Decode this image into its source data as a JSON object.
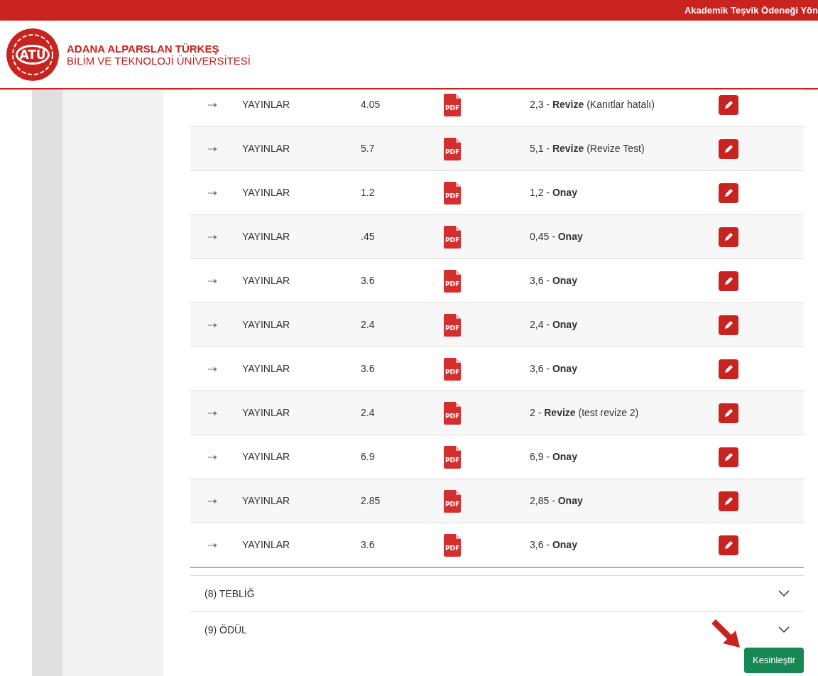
{
  "top_bar": {
    "title": "Akademik Teşvik Ödeneği Yön"
  },
  "logo": {
    "mark": "ATÜ",
    "line_1": "ADANA ALPARSLAN TÜRKEŞ",
    "line_2": "BİLİM VE TEKNOLOJİ ÜNİVERSİTESİ"
  },
  "table": {
    "rows": [
      {
        "category": "YAYINLAR",
        "score": "4.05",
        "file": "PDF",
        "status": "2,3 - **Revize** (Kanıtlar hatalı)"
      },
      {
        "category": "YAYINLAR",
        "score": "5.7",
        "file": "PDF",
        "status": "5,1 - **Revize** (Revize Test)"
      },
      {
        "category": "YAYINLAR",
        "score": "1.2",
        "file": "PDF",
        "status": "1,2 - **Onay**"
      },
      {
        "category": "YAYINLAR",
        "score": ".45",
        "file": "PDF",
        "status": "0,45 - **Onay**"
      },
      {
        "category": "YAYINLAR",
        "score": "3.6",
        "file": "PDF",
        "status": "3,6 - **Onay**"
      },
      {
        "category": "YAYINLAR",
        "score": "2.4",
        "file": "PDF",
        "status": "2,4 - **Onay**"
      },
      {
        "category": "YAYINLAR",
        "score": "3.6",
        "file": "PDF",
        "status": "3,6 - **Onay**"
      },
      {
        "category": "YAYINLAR",
        "score": "2.4",
        "file": "PDF",
        "status": "2 - **Revize** (test revize 2)"
      },
      {
        "category": "YAYINLAR",
        "score": "6.9",
        "file": "PDF",
        "status": "6,9 - **Onay**"
      },
      {
        "category": "YAYINLAR",
        "score": "2.85",
        "file": "PDF",
        "status": "2,85 - **Onay**"
      },
      {
        "category": "YAYINLAR",
        "score": "3.6",
        "file": "PDF",
        "status": "3,6 - **Onay**"
      }
    ]
  },
  "sections": [
    {
      "label": "(8) TEBLİĞ",
      "expanded": false
    },
    {
      "label": "(9) ÖDÜL",
      "expanded": false
    }
  ],
  "finalize_button": "Kesinleştir"
}
